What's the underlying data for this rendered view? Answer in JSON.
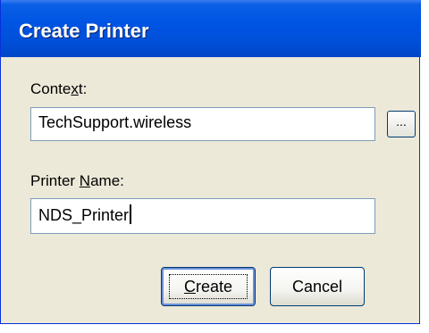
{
  "window": {
    "title": "Create Printer"
  },
  "context": {
    "label_pre": "Conte",
    "label_key": "x",
    "label_post": "t:",
    "value": "TechSupport.wireless",
    "browse_label": "..."
  },
  "printer_name": {
    "label_pre": "Printer ",
    "label_key": "N",
    "label_post": "ame:",
    "value": "NDS_Printer"
  },
  "buttons": {
    "create_key": "C",
    "create_rest": "reate",
    "cancel": "Cancel"
  },
  "colors": {
    "titlebar": "#0054e3",
    "dialog_bg": "#ece9d8",
    "input_border": "#7f9db9"
  }
}
